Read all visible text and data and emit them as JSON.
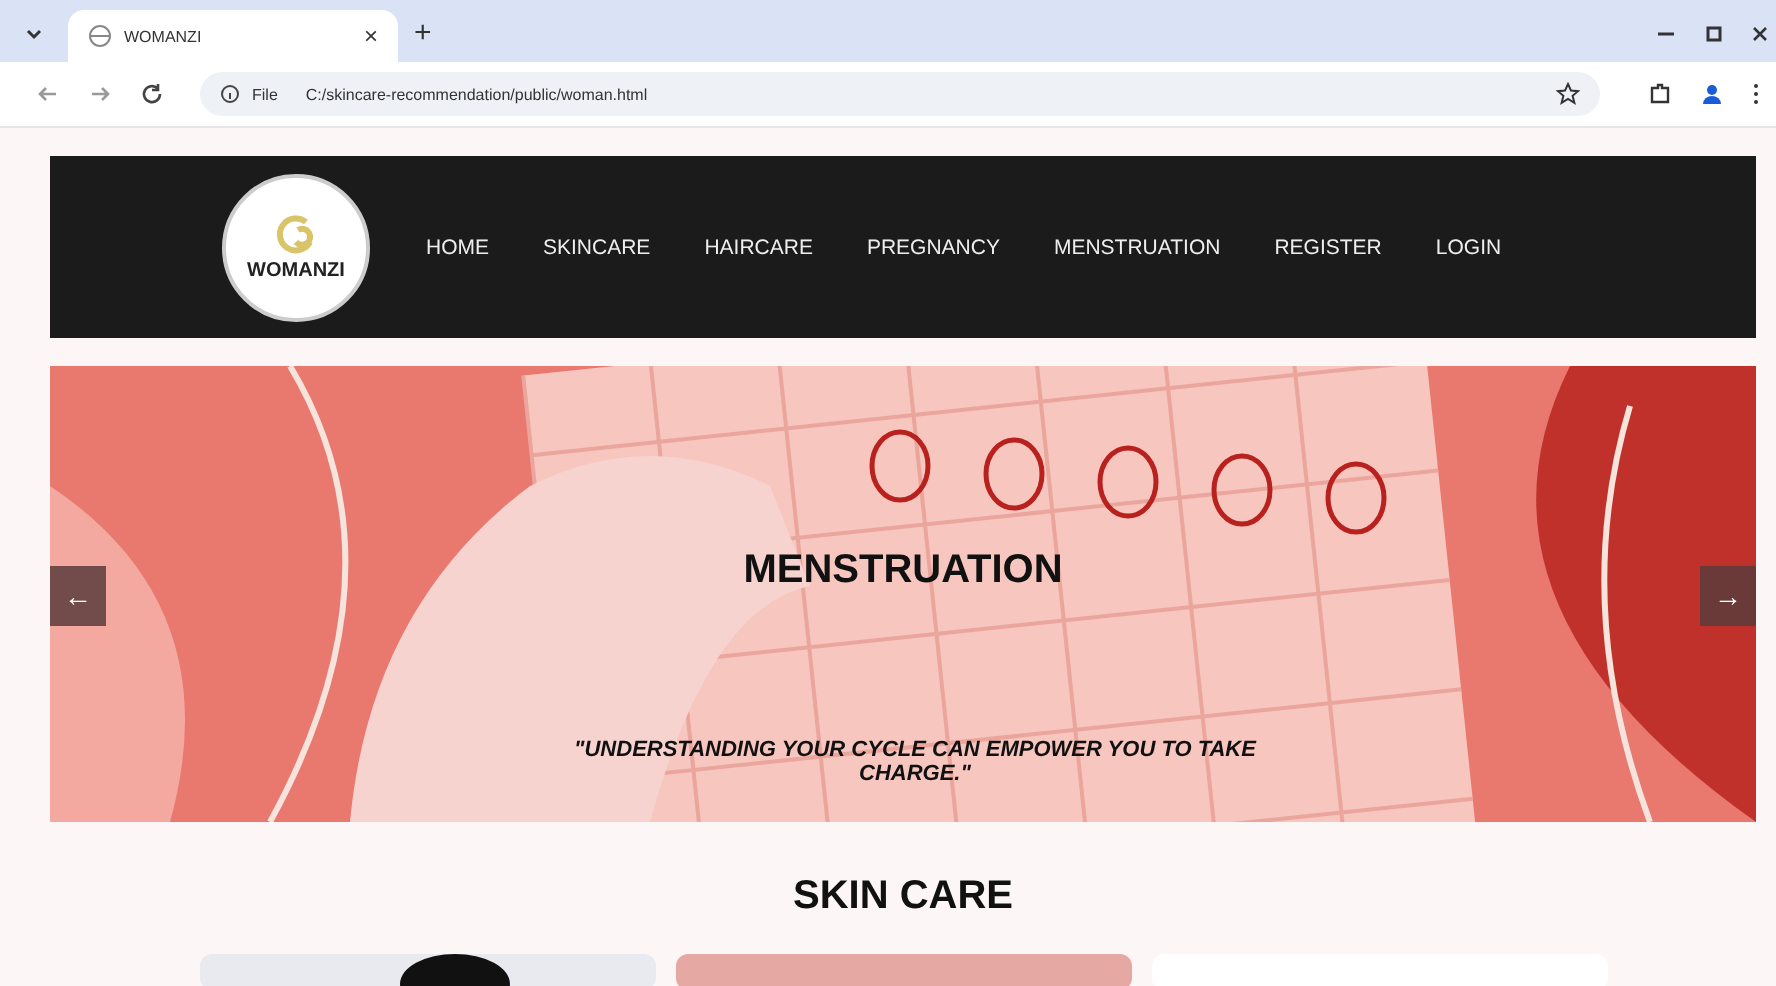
{
  "browser": {
    "tab": {
      "title": "WOMANZI",
      "close": "×"
    },
    "new_tab": "+",
    "address": {
      "scheme": "File",
      "url": "C:/skincare-recommendation/public/woman.html"
    }
  },
  "nav": {
    "logo": "WOMANZI",
    "items": [
      {
        "label": "HOME"
      },
      {
        "label": "SKINCARE"
      },
      {
        "label": "HAIRCARE"
      },
      {
        "label": "PREGNANCY"
      },
      {
        "label": "MENSTRUATION"
      },
      {
        "label": "REGISTER"
      },
      {
        "label": "LOGIN"
      }
    ]
  },
  "banner": {
    "title": "MENSTRUATION",
    "quote": "\"UNDERSTANDING YOUR CYCLE CAN EMPOWER YOU TO TAKE CHARGE.\"",
    "prev": "←",
    "next": "→"
  },
  "section": {
    "title": "SKIN CARE",
    "cards": [
      {
        "kind": "photo"
      },
      {
        "kind": "pink"
      },
      {
        "kind": "text"
      }
    ]
  }
}
